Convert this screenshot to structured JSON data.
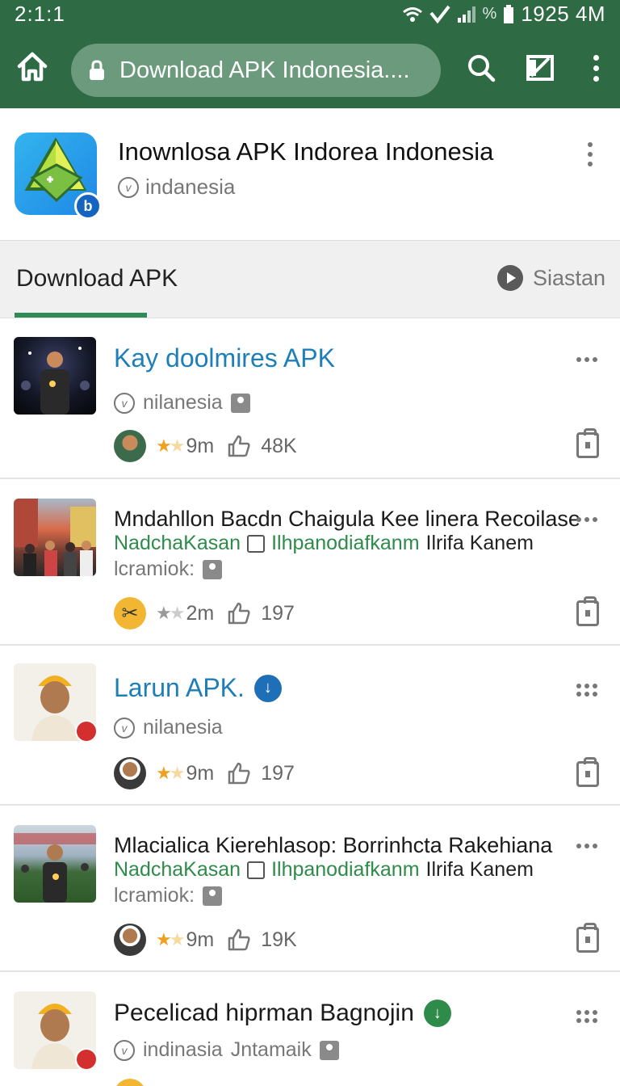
{
  "status_bar": {
    "time": "2:1:1",
    "battery_pct_label": "%",
    "clock": "1925 4M"
  },
  "toolbar": {
    "url_text": "Download APK Indonesia...."
  },
  "site": {
    "title": "Inownlosa APK Indorea Indonesia",
    "subtitle": "indanesia",
    "badge": "b"
  },
  "tabs": {
    "main": "Download APK",
    "right": "Siastan"
  },
  "colors": {
    "appbar": "#2e6b45",
    "url_pill": "#6c9a7c",
    "link_blue": "#1e7fb8",
    "green_text": "#2e8b4a",
    "tab_underline": "#2e8b57"
  },
  "items": [
    {
      "title": "Kay doolmires APK",
      "sub": "nilanesia",
      "time": "9m",
      "likes": "48K"
    },
    {
      "title": "Mndahllon Bacdn Chaigula Kee linera Recoilase",
      "green_a": "NadchaKasan",
      "green_b": "Ilhpanodiafkanm",
      "black": "Ilrifa Kanem",
      "sub": "lcramiok:",
      "time": "2m",
      "likes": "197"
    },
    {
      "title": "Larun APK.",
      "sub": "nilanesia",
      "time": "9m",
      "likes": "197"
    },
    {
      "title": "Mlacialica Kierehlasop: Borrinhcta Rakehiana",
      "green_a": "NadchaKasan",
      "green_b": "Ilhpanodiafkanm",
      "black": "Ilrifa Kanem",
      "sub": "lcramiok:",
      "time": "9m",
      "likes": "19K"
    },
    {
      "title": "Pecelicad hiprman Bagnojin",
      "sub": "indinasia",
      "sub2": "Jntamaik"
    }
  ]
}
